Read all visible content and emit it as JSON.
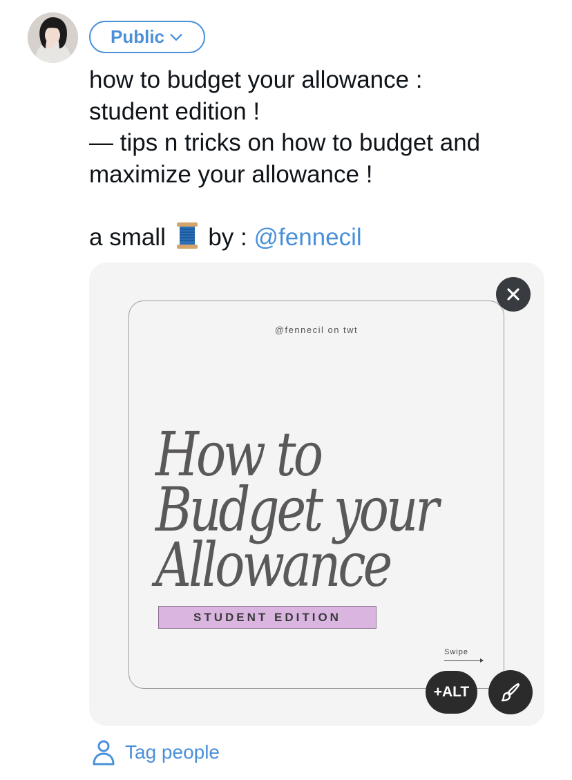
{
  "composer": {
    "avatar_icon": "user-avatar-photo",
    "audience": {
      "label": "Public",
      "icon": "chevron-down-icon"
    },
    "tweet": {
      "line1": "how to budget your allowance :",
      "line2": "student edition !",
      "line3": "— tips n tricks on how to budget and",
      "line4": "maximize your allowance !",
      "line5_prefix": "a small",
      "line5_emoji": "spool-of-thread-emoji",
      "line5_by": "by :",
      "mention": "@fennecil"
    },
    "accent_color": "#4a90d9"
  },
  "media": {
    "handle": "@fennecil on twt",
    "title_line1": "How to",
    "title_line2": "Budget your",
    "title_line3": "Allowance",
    "edition": "STUDENT EDITION",
    "swipe": "Swipe",
    "close_icon": "close-icon",
    "alt_label": "+ALT",
    "edit_icon": "paintbrush-icon"
  },
  "footer": {
    "tag_people_label": "Tag people",
    "tag_people_icon": "person-icon"
  }
}
